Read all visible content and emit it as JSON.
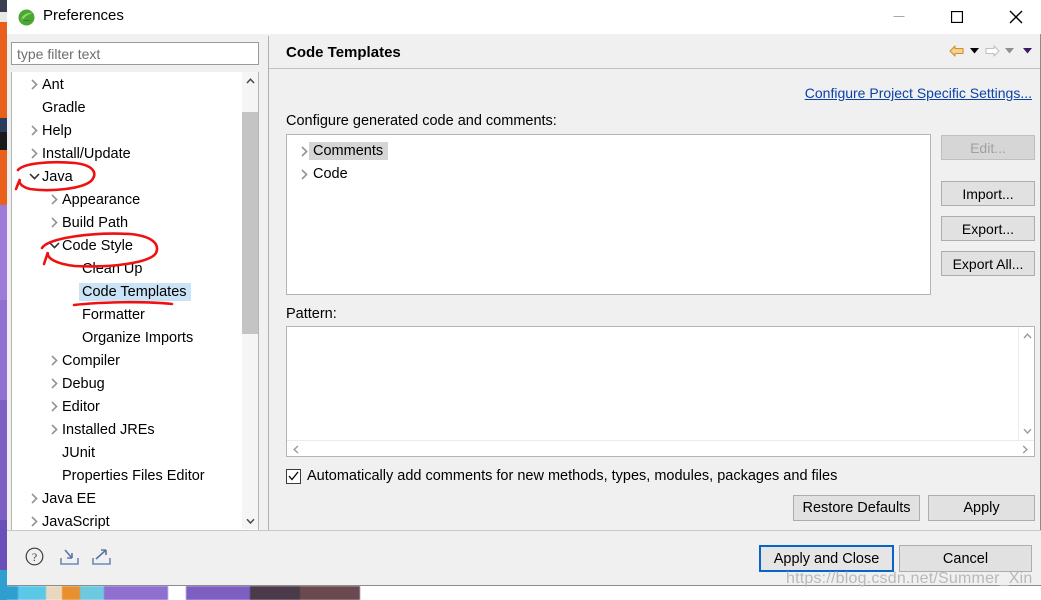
{
  "window": {
    "title": "Preferences",
    "icon": "eclipse-icon",
    "controls": {
      "minimize": "minimize-icon",
      "maximize": "maximize-icon",
      "close": "close-icon"
    }
  },
  "sidebar": {
    "filter": {
      "placeholder": "type filter text",
      "value": ""
    },
    "items": [
      {
        "label": "Ant",
        "indent": 0,
        "twisty": "collapsed",
        "selected": false
      },
      {
        "label": "Gradle",
        "indent": 0,
        "twisty": "none",
        "selected": false
      },
      {
        "label": "Help",
        "indent": 0,
        "twisty": "collapsed",
        "selected": false
      },
      {
        "label": "Install/Update",
        "indent": 0,
        "twisty": "collapsed",
        "selected": false
      },
      {
        "label": "Java",
        "indent": 0,
        "twisty": "expanded",
        "selected": false
      },
      {
        "label": "Appearance",
        "indent": 1,
        "twisty": "collapsed",
        "selected": false
      },
      {
        "label": "Build Path",
        "indent": 1,
        "twisty": "collapsed",
        "selected": false
      },
      {
        "label": "Code Style",
        "indent": 1,
        "twisty": "expanded",
        "selected": false
      },
      {
        "label": "Clean Up",
        "indent": 2,
        "twisty": "none",
        "selected": false
      },
      {
        "label": "Code Templates",
        "indent": 2,
        "twisty": "none",
        "selected": true
      },
      {
        "label": "Formatter",
        "indent": 2,
        "twisty": "none",
        "selected": false
      },
      {
        "label": "Organize Imports",
        "indent": 2,
        "twisty": "none",
        "selected": false
      },
      {
        "label": "Compiler",
        "indent": 1,
        "twisty": "collapsed",
        "selected": false
      },
      {
        "label": "Debug",
        "indent": 1,
        "twisty": "collapsed",
        "selected": false
      },
      {
        "label": "Editor",
        "indent": 1,
        "twisty": "collapsed",
        "selected": false
      },
      {
        "label": "Installed JREs",
        "indent": 1,
        "twisty": "collapsed",
        "selected": false
      },
      {
        "label": "JUnit",
        "indent": 1,
        "twisty": "none",
        "selected": false
      },
      {
        "label": "Properties Files Editor",
        "indent": 1,
        "twisty": "none",
        "selected": false
      },
      {
        "label": "Java EE",
        "indent": 0,
        "twisty": "collapsed",
        "selected": false
      },
      {
        "label": "JavaScript",
        "indent": 0,
        "twisty": "collapsed",
        "selected": false
      }
    ],
    "scrollbar": {
      "up_icon": "chevron-up-icon",
      "down_icon": "chevron-down-icon"
    }
  },
  "main": {
    "page_title": "Code Templates",
    "nav": {
      "back_icon": "back-arrow-icon",
      "back_menu_icon": "caret-down-icon",
      "forward_icon": "forward-arrow-icon",
      "forward_menu_icon": "caret-down-icon",
      "view_menu_icon": "caret-down-icon"
    },
    "project_link": "Configure Project Specific Settings...",
    "configure_label": "Configure generated code and comments:",
    "template_tree": [
      {
        "label": "Comments",
        "twisty": "collapsed",
        "selected": true
      },
      {
        "label": "Code",
        "twisty": "collapsed",
        "selected": false
      }
    ],
    "side_buttons": [
      {
        "label": "Edit...",
        "disabled": true
      },
      {
        "label": "Import...",
        "disabled": false
      },
      {
        "label": "Export...",
        "disabled": false
      },
      {
        "label": "Export All...",
        "disabled": false
      }
    ],
    "pattern_label": "Pattern:",
    "pattern_value": "",
    "auto_comment": {
      "label": "Automatically add comments for new methods, types, modules, packages and files",
      "checked": true
    },
    "restore_defaults": "Restore Defaults",
    "apply": "Apply"
  },
  "footer": {
    "help_icon": "help-icon",
    "import_icon": "import-preferences-icon",
    "export_icon": "export-preferences-icon",
    "apply_and_close": "Apply and Close",
    "cancel": "Cancel"
  },
  "watermark": "https://blog.csdn.net/Summer_Xin",
  "colors": {
    "selection_blue": "#cbe3f7",
    "focus_border": "#0a64c8",
    "link": "#0c42a8",
    "annotation_red": "#ee1111",
    "back_arrow": "#e8a33d"
  }
}
